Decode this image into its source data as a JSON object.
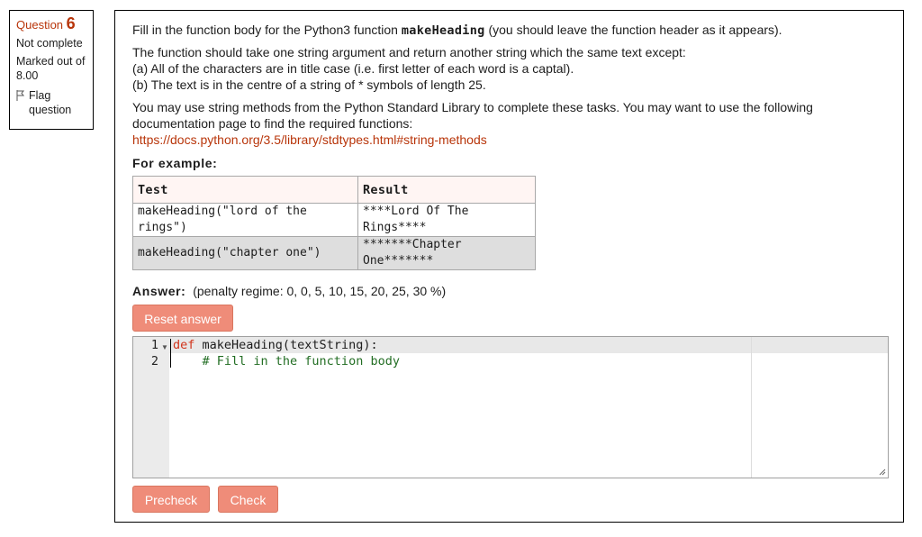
{
  "info": {
    "question_label": "Question",
    "question_number": "6",
    "status": "Not complete",
    "marks": "Marked out of 8.00",
    "flag_label": "Flag question"
  },
  "question": {
    "intro_before": "Fill in the function body for the Python3 function ",
    "function_name": "makeHeading",
    "intro_after": " (you should leave the function header as it appears).",
    "desc_line1": "The function should take one string argument and return another string which the same text except:",
    "desc_line2": "(a) All of the characters are in title case (i.e. first letter of each word is a captal).",
    "desc_line3": "(b) The text is in the centre of a string of * symbols of length 25.",
    "hint_line1": "You may use string methods from the Python Standard Library to complete these tasks.  You may want to use the following",
    "hint_line2": "documentation page to find the required functions:",
    "doc_link": "https://docs.python.org/3.5/library/stdtypes.html#string-methods",
    "for_example": "For example:"
  },
  "examples": {
    "headers": [
      "Test",
      "Result"
    ],
    "rows": [
      {
        "test": "makeHeading(\"lord of the rings\")",
        "result": "****Lord Of The Rings****"
      },
      {
        "test": "makeHeading(\"chapter one\")",
        "result": "*******Chapter One*******"
      }
    ]
  },
  "answer": {
    "label": "Answer:",
    "penalty": "(penalty regime: 0, 0, 5, 10, 15, 20, 25, 30 %)",
    "reset_label": "Reset answer"
  },
  "editor": {
    "lines": [
      {
        "num": "1",
        "keyword": "def",
        "rest": " makeHeading(textString):"
      },
      {
        "num": "2",
        "comment": "    # Fill in the function body"
      }
    ]
  },
  "buttons": {
    "precheck": "Precheck",
    "check": "Check"
  },
  "colors": {
    "accent": "#b8350a",
    "button": "#ef8c79",
    "keyword": "#d1331a",
    "comment": "#236e24"
  }
}
